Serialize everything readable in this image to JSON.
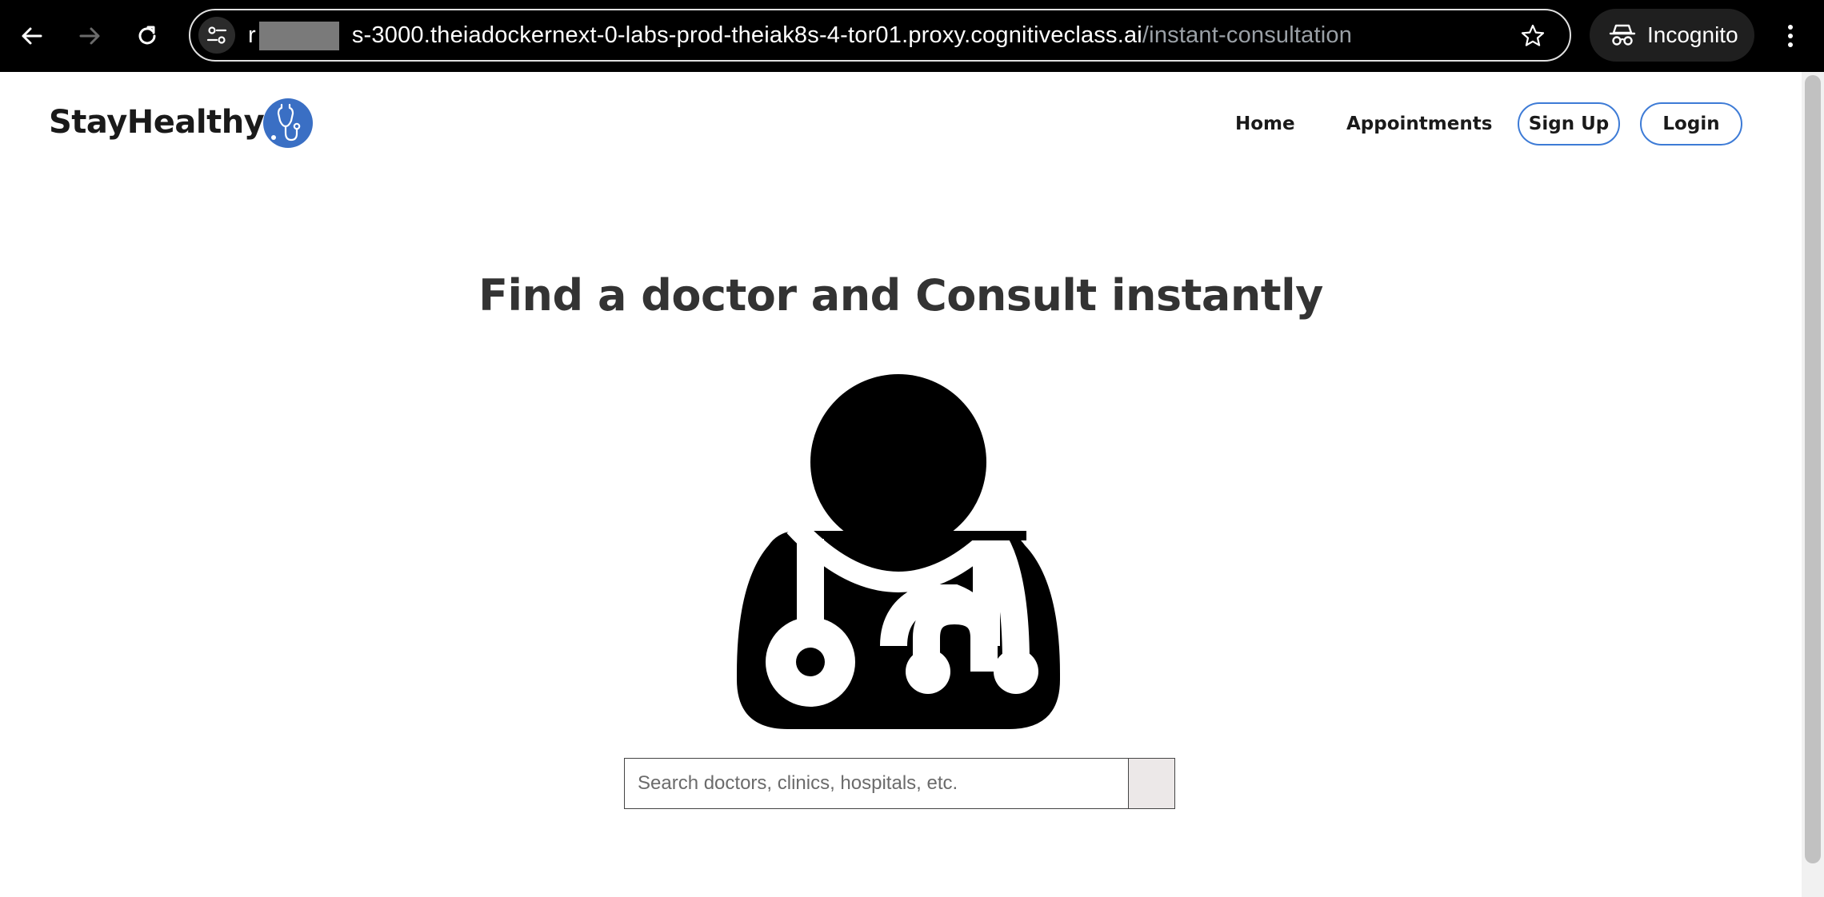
{
  "browser": {
    "url_host": "s-3000.theiadockernext-0-labs-prod-theiak8s-4-tor01.proxy.cognitiveclass.ai",
    "url_prefix": "r",
    "url_path": "/instant-consultation",
    "incognito_label": "Incognito",
    "icons": {
      "back": "back-arrow-icon",
      "forward": "forward-arrow-icon",
      "reload": "reload-icon",
      "site_info": "tune-icon",
      "bookmark": "star-icon",
      "incognito": "incognito-icon",
      "menu": "kebab-menu-icon"
    }
  },
  "header": {
    "logo_text": "StayHealthy",
    "logo_icon": "stethoscope-icon",
    "nav": {
      "home": "Home",
      "appointments": "Appointments",
      "signup": "Sign Up",
      "login": "Login"
    }
  },
  "main": {
    "title": "Find a doctor and Consult instantly",
    "illustration": "doctor-icon",
    "search": {
      "placeholder": "Search doctors, clinics, hospitals, etc.",
      "value": ""
    }
  },
  "colors": {
    "accent": "#3d7bd6",
    "logo_circle": "#3a6fc4",
    "title_text": "#333333",
    "search_button": "#ece8e8"
  }
}
